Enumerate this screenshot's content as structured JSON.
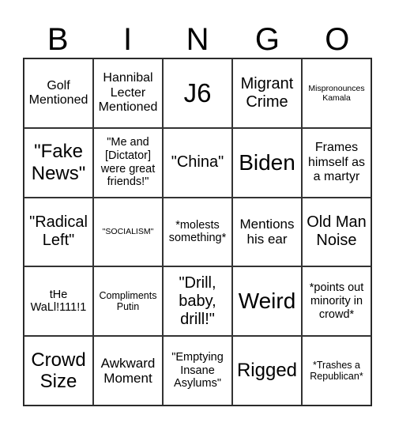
{
  "title_letters": [
    "B",
    "I",
    "N",
    "G",
    "O"
  ],
  "rows": [
    [
      "Golf Mentioned",
      "Hannibal Lecter Mentioned",
      "J6",
      "Migrant Crime",
      "Mispronounces Kamala"
    ],
    [
      "\"Fake News\"",
      "\"Me and [Dictator] were great friends!\"",
      "\"China\"",
      "Biden",
      "Frames himself as a martyr"
    ],
    [
      "\"Radical Left\"",
      "\"SOCIALISM\"",
      "*molests something*",
      "Mentions his ear",
      "Old Man Noise"
    ],
    [
      "tHe WaLl!111!1",
      "Compliments Putin",
      "\"Drill, baby, drill!\"",
      "Weird",
      "*points out minority in crowd*"
    ],
    [
      "Crowd Size",
      "Awkward Moment",
      "\"Emptying Insane Asylums\"",
      "Rigged",
      "*Trashes a Republican*"
    ]
  ]
}
